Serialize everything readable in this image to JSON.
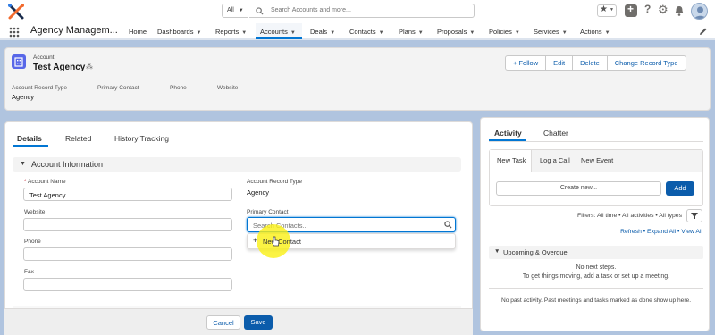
{
  "header": {
    "search_scope": "All",
    "search_placeholder": "Search Accounts and more...",
    "icons": [
      "favorites-icon",
      "add-icon",
      "help-icon",
      "setup-gear-icon",
      "notifications-bell-icon",
      "avatar"
    ]
  },
  "nav": {
    "app_name": "Agency Managem...",
    "items": [
      {
        "label": "Home",
        "dropdown": false
      },
      {
        "label": "Dashboards",
        "dropdown": true
      },
      {
        "label": "Reports",
        "dropdown": true
      },
      {
        "label": "Accounts",
        "dropdown": true
      },
      {
        "label": "Deals",
        "dropdown": true
      },
      {
        "label": "Contacts",
        "dropdown": true
      },
      {
        "label": "Plans",
        "dropdown": true
      },
      {
        "label": "Proposals",
        "dropdown": true
      },
      {
        "label": "Policies",
        "dropdown": true
      },
      {
        "label": "Services",
        "dropdown": true
      },
      {
        "label": "Actions",
        "dropdown": true
      }
    ],
    "active_item": "Accounts"
  },
  "record": {
    "object_label": "Account",
    "name": "Test Agency",
    "actions": {
      "follow": "+ Follow",
      "edit": "Edit",
      "delete": "Delete",
      "change_record_type": "Change Record Type"
    },
    "highlights": {
      "account_record_type_label": "Account Record Type",
      "account_record_type_value": "Agency",
      "primary_contact_label": "Primary Contact",
      "phone_label": "Phone",
      "website_label": "Website"
    }
  },
  "details": {
    "tabs": [
      "Details",
      "Related",
      "History Tracking"
    ],
    "active_tab": "Details",
    "section_title": "Account Information",
    "fields": {
      "account_name_label": "Account Name",
      "account_name_value": "Test Agency",
      "website_label": "Website",
      "phone_label": "Phone",
      "fax_label": "Fax",
      "record_type_label": "Account Record Type",
      "record_type_value": "Agency",
      "primary_contact_label": "Primary Contact",
      "primary_contact_placeholder": "Search Contacts..."
    },
    "lookup_dropdown": {
      "new_contact_label": "New Contact"
    },
    "footer": {
      "cancel": "Cancel",
      "save": "Save"
    }
  },
  "activity": {
    "tabs": [
      "Activity",
      "Chatter"
    ],
    "composer_tabs": [
      "New Task",
      "Log a Call",
      "New Event"
    ],
    "create_new_placeholder": "Create new...",
    "add_label": "Add",
    "filters_text": "Filters: All time • All activities • All types",
    "links": "Refresh • Expand All • View All",
    "upcoming_title": "Upcoming & Overdue",
    "no_next_steps": "No next steps.",
    "no_next_steps_sub": "To get things moving, add a task or set up a meeting.",
    "no_past_activity": "No past activity. Past meetings and tasks marked as done show up here."
  },
  "colors": {
    "brand_blue": "#0176d3",
    "button_blue": "#0b5cab",
    "page_bg": "#b0c4df",
    "highlight_yellow": "#faf014"
  }
}
